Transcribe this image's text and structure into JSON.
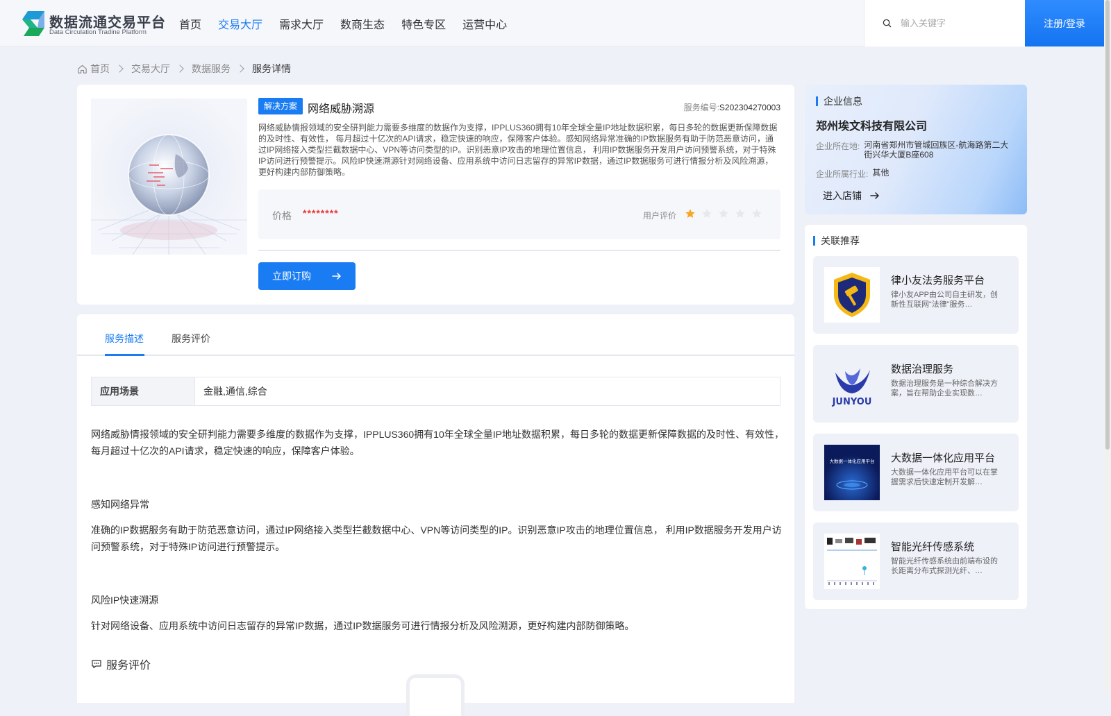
{
  "header": {
    "logo_title": "数据流通交易平台",
    "logo_subtitle": "Data Circulation Tradine Platform",
    "nav": [
      "首页",
      "交易大厅",
      "需求大厅",
      "数商生态",
      "特色专区",
      "运营中心"
    ],
    "nav_active": "交易大厅",
    "search_placeholder": "输入关键字",
    "login_label": "注册/登录",
    "accent_color": "#1a7cf2"
  },
  "breadcrumb": [
    "首页",
    "交易大厅",
    "数据服务",
    "服务详情"
  ],
  "service": {
    "tag": "解决方案",
    "name": "网络威胁溯源",
    "number_label": "服务编号:",
    "number": "S202304270003",
    "description": "网络威胁情报领域的安全研判能力需要多维度的数据作为支撑，IPPLUS360拥有10年全球全量IP地址数据积累，每日多轮的数据更新保障数据的及时性、有效性， 每月超过十亿次的API请求，稳定快速的响应，保障客户体验。感知网络异常准确的IP数据服务有助于防范恶意访问，通过IP网络接入类型拦截数据中心、VPN等访问类型的IP。识别恶意IP攻击的地理位置信息， 利用IP数据服务开发用户访问预警系统，对于特殊IP访问进行预警提示。风险IP快速溯源针对网络设备、应用系统中访问日志留存的异常IP数据，通过IP数据服务可进行情报分析及风险溯源，更好构建内部防御策略。",
    "price_label": "价格",
    "price": "********",
    "rating_label": "用户评价",
    "rating": 1,
    "rating_max": 5,
    "buy_label": "立即订购"
  },
  "tabs": [
    "服务描述",
    "服务评价"
  ],
  "tab_active": "服务描述",
  "attributes": {
    "key": "应用场景",
    "value": "金融,通信,综合"
  },
  "content": {
    "p1": "网络威胁情报领域的安全研判能力需要多维度的数据作为支撑，IPPLUS360拥有10年全球全量IP地址数据积累，每日多轮的数据更新保障数据的及时性、有效性， 每月超过十亿次的API请求，稳定快速的响应，保障客户体验。",
    "h1": "感知网络异常",
    "p2": "准确的IP数据服务有助于防范恶意访问，通过IP网络接入类型拦截数据中心、VPN等访问类型的IP。识别恶意IP攻击的地理位置信息， 利用IP数据服务开发用户访问预警系统，对于特殊IP访问进行预警提示。",
    "h2": "风险IP快速溯源",
    "p3": "针对网络设备、应用系统中访问日志留存的异常IP数据，通过IP数据服务可进行情报分析及风险溯源，更好构建内部防御策略。",
    "review_title": "服务评价"
  },
  "company": {
    "section_title": "企业信息",
    "name": "郑州埃文科技有限公司",
    "location_label": "企业所在地:",
    "location": "河南省郑州市管城回族区-航海路第二大街兴华大厦B座608",
    "industry_label": "企业所属行业:",
    "industry": "其他",
    "shop_label": "进入店铺"
  },
  "recommend": {
    "section_title": "关联推荐",
    "items": [
      {
        "title": "律小友法务服务平台",
        "desc": "律小友APP由公司自主研发，创新性互联网“法律”服务…"
      },
      {
        "title": "数据治理服务",
        "desc": "数据治理服务是一种综合解决方案，旨在帮助企业实现数…",
        "logo_text": "JUNYOU"
      },
      {
        "title": "大数据一体化应用平台",
        "desc": "大数据一体化应用平台可以在掌握需求后快速定制开发解…",
        "logo_text": "大数据一体化应用平台"
      },
      {
        "title": "智能光纤传感系统",
        "desc": "智能光纤传感系统由前端布设的长距离分布式探测光纤、…"
      }
    ]
  }
}
